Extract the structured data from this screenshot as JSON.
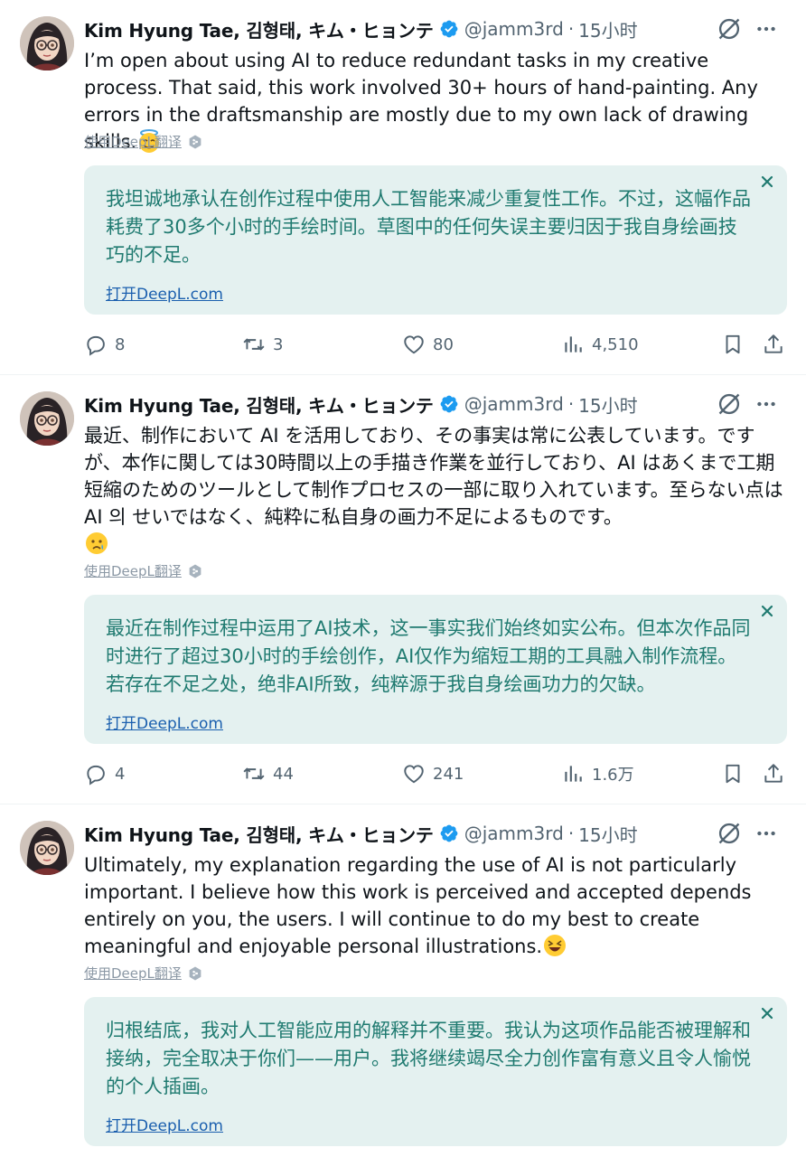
{
  "tweets": [
    {
      "author": {
        "name": "Kim Hyung Tae, 김형태, キム・ヒョンテ",
        "handle": "@jamm3rd",
        "time": "15小时"
      },
      "text": "I’m open about using AI to reduce redundant tasks in my creative process. That said, this work involved 30+ hours of hand-painting. Any errors in the draftsmanship are mostly due to my own lack of drawing skills.",
      "emoji": "smiling-face-with-halo",
      "translate_label": "使用DeepL翻译",
      "translation": "我坦诚地承认在创作过程中使用人工智能来减少重复性工作。不过，这幅作品耗费了30多个小时的手绘时间。草图中的任何失误主要归因于我自身绘画技巧的不足。",
      "open_link": "打开DeepL.com",
      "stats": {
        "replies": "8",
        "retweets": "3",
        "likes": "80",
        "views": "4,510"
      }
    },
    {
      "author": {
        "name": "Kim Hyung Tae, 김형태, キム・ヒョンテ",
        "handle": "@jamm3rd",
        "time": "15小时"
      },
      "text": "最近、制作において AI を活用しており、その事実は常に公表しています。ですが、本作に関しては30時間以上の手描き作業を並行しており、AI はあくまで工期短縮のためのツールとして制作プロセスの一部に取り入れています。至らない点は AI 의 せいではなく、純粋に私自身の画力不足によるものです。",
      "emoji": "sad-face",
      "translate_label": "使用DeepL翻译",
      "translation": "最近在制作过程中运用了AI技术，这一事实我们始终如实公布。但本次作品同时进行了超过30小时的手绘创作，AI仅作为缩短工期的工具融入制作流程。若存在不足之处，绝非AI所致，纯粹源于我自身绘画功力的欠缺。",
      "open_link": "打开DeepL.com",
      "stats": {
        "replies": "4",
        "retweets": "44",
        "likes": "241",
        "views": "1.6万"
      }
    },
    {
      "author": {
        "name": "Kim Hyung Tae, 김형태, キム・ヒョンテ",
        "handle": "@jamm3rd",
        "time": "15小时"
      },
      "text": "Ultimately, my explanation regarding the use of AI is not particularly important. I believe how this work is perceived and accepted depends entirely on you, the users. I will continue to do my best to create meaningful and enjoyable personal illustrations.",
      "emoji": "grinning-squinting-face",
      "translate_label": "使用DeepL翻译",
      "translation": "归根结底，我对人工智能应用的解释并不重要。我认为这项作品能否被理解和接纳，完全取决于你们——用户。我将继续竭尽全力创作富有意义且令人愉悦的个人插画。",
      "open_link": "打开DeepL.com"
    }
  ],
  "colors": {
    "accent": "#1d9bf0",
    "translation_bg": "#e4f1f0",
    "translation_text": "#1f7a70",
    "link": "#1a5fae",
    "muted": "#536471"
  }
}
